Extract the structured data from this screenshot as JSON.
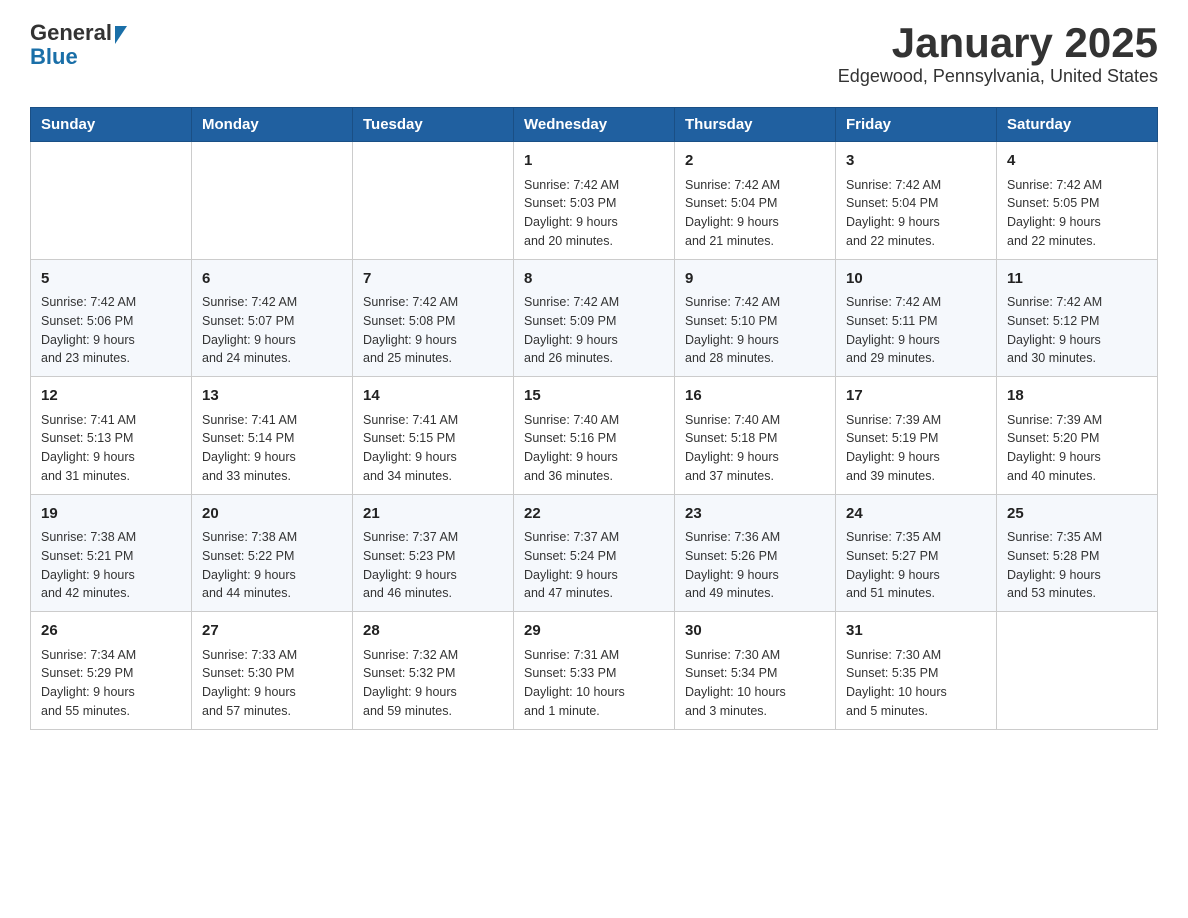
{
  "logo": {
    "line1": "General",
    "line2": "Blue"
  },
  "title": "January 2025",
  "subtitle": "Edgewood, Pennsylvania, United States",
  "days_of_week": [
    "Sunday",
    "Monday",
    "Tuesday",
    "Wednesday",
    "Thursday",
    "Friday",
    "Saturday"
  ],
  "weeks": [
    [
      {
        "day": "",
        "info": ""
      },
      {
        "day": "",
        "info": ""
      },
      {
        "day": "",
        "info": ""
      },
      {
        "day": "1",
        "info": "Sunrise: 7:42 AM\nSunset: 5:03 PM\nDaylight: 9 hours\nand 20 minutes."
      },
      {
        "day": "2",
        "info": "Sunrise: 7:42 AM\nSunset: 5:04 PM\nDaylight: 9 hours\nand 21 minutes."
      },
      {
        "day": "3",
        "info": "Sunrise: 7:42 AM\nSunset: 5:04 PM\nDaylight: 9 hours\nand 22 minutes."
      },
      {
        "day": "4",
        "info": "Sunrise: 7:42 AM\nSunset: 5:05 PM\nDaylight: 9 hours\nand 22 minutes."
      }
    ],
    [
      {
        "day": "5",
        "info": "Sunrise: 7:42 AM\nSunset: 5:06 PM\nDaylight: 9 hours\nand 23 minutes."
      },
      {
        "day": "6",
        "info": "Sunrise: 7:42 AM\nSunset: 5:07 PM\nDaylight: 9 hours\nand 24 minutes."
      },
      {
        "day": "7",
        "info": "Sunrise: 7:42 AM\nSunset: 5:08 PM\nDaylight: 9 hours\nand 25 minutes."
      },
      {
        "day": "8",
        "info": "Sunrise: 7:42 AM\nSunset: 5:09 PM\nDaylight: 9 hours\nand 26 minutes."
      },
      {
        "day": "9",
        "info": "Sunrise: 7:42 AM\nSunset: 5:10 PM\nDaylight: 9 hours\nand 28 minutes."
      },
      {
        "day": "10",
        "info": "Sunrise: 7:42 AM\nSunset: 5:11 PM\nDaylight: 9 hours\nand 29 minutes."
      },
      {
        "day": "11",
        "info": "Sunrise: 7:42 AM\nSunset: 5:12 PM\nDaylight: 9 hours\nand 30 minutes."
      }
    ],
    [
      {
        "day": "12",
        "info": "Sunrise: 7:41 AM\nSunset: 5:13 PM\nDaylight: 9 hours\nand 31 minutes."
      },
      {
        "day": "13",
        "info": "Sunrise: 7:41 AM\nSunset: 5:14 PM\nDaylight: 9 hours\nand 33 minutes."
      },
      {
        "day": "14",
        "info": "Sunrise: 7:41 AM\nSunset: 5:15 PM\nDaylight: 9 hours\nand 34 minutes."
      },
      {
        "day": "15",
        "info": "Sunrise: 7:40 AM\nSunset: 5:16 PM\nDaylight: 9 hours\nand 36 minutes."
      },
      {
        "day": "16",
        "info": "Sunrise: 7:40 AM\nSunset: 5:18 PM\nDaylight: 9 hours\nand 37 minutes."
      },
      {
        "day": "17",
        "info": "Sunrise: 7:39 AM\nSunset: 5:19 PM\nDaylight: 9 hours\nand 39 minutes."
      },
      {
        "day": "18",
        "info": "Sunrise: 7:39 AM\nSunset: 5:20 PM\nDaylight: 9 hours\nand 40 minutes."
      }
    ],
    [
      {
        "day": "19",
        "info": "Sunrise: 7:38 AM\nSunset: 5:21 PM\nDaylight: 9 hours\nand 42 minutes."
      },
      {
        "day": "20",
        "info": "Sunrise: 7:38 AM\nSunset: 5:22 PM\nDaylight: 9 hours\nand 44 minutes."
      },
      {
        "day": "21",
        "info": "Sunrise: 7:37 AM\nSunset: 5:23 PM\nDaylight: 9 hours\nand 46 minutes."
      },
      {
        "day": "22",
        "info": "Sunrise: 7:37 AM\nSunset: 5:24 PM\nDaylight: 9 hours\nand 47 minutes."
      },
      {
        "day": "23",
        "info": "Sunrise: 7:36 AM\nSunset: 5:26 PM\nDaylight: 9 hours\nand 49 minutes."
      },
      {
        "day": "24",
        "info": "Sunrise: 7:35 AM\nSunset: 5:27 PM\nDaylight: 9 hours\nand 51 minutes."
      },
      {
        "day": "25",
        "info": "Sunrise: 7:35 AM\nSunset: 5:28 PM\nDaylight: 9 hours\nand 53 minutes."
      }
    ],
    [
      {
        "day": "26",
        "info": "Sunrise: 7:34 AM\nSunset: 5:29 PM\nDaylight: 9 hours\nand 55 minutes."
      },
      {
        "day": "27",
        "info": "Sunrise: 7:33 AM\nSunset: 5:30 PM\nDaylight: 9 hours\nand 57 minutes."
      },
      {
        "day": "28",
        "info": "Sunrise: 7:32 AM\nSunset: 5:32 PM\nDaylight: 9 hours\nand 59 minutes."
      },
      {
        "day": "29",
        "info": "Sunrise: 7:31 AM\nSunset: 5:33 PM\nDaylight: 10 hours\nand 1 minute."
      },
      {
        "day": "30",
        "info": "Sunrise: 7:30 AM\nSunset: 5:34 PM\nDaylight: 10 hours\nand 3 minutes."
      },
      {
        "day": "31",
        "info": "Sunrise: 7:30 AM\nSunset: 5:35 PM\nDaylight: 10 hours\nand 5 minutes."
      },
      {
        "day": "",
        "info": ""
      }
    ]
  ]
}
